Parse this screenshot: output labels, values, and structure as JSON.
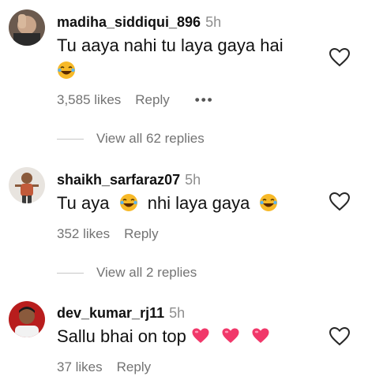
{
  "comments": [
    {
      "username": "madiha_siddiqui_896",
      "time": "5h",
      "text": "Tu aaya nahi tu laya gaya hai",
      "likes": "3,585 likes",
      "reply_label": "Reply",
      "more_label": "•••",
      "view_replies": "View all 62 replies",
      "emojis": [
        "laughing-emoji"
      ]
    },
    {
      "username": "shaikh_sarfaraz07",
      "time": "5h",
      "text_part1": "Tu aya",
      "text_part2": "nhi laya gaya",
      "likes": "352 likes",
      "reply_label": "Reply",
      "view_replies": "View all 2 replies",
      "emojis": [
        "laughing-emoji",
        "laughing-emoji"
      ]
    },
    {
      "username": "dev_kumar_rj11",
      "time": "5h",
      "text": "Sallu bhai on top",
      "likes": "37 likes",
      "reply_label": "Reply",
      "emojis": [
        "pink-heart-emoji",
        "pink-heart-emoji",
        "pink-heart-emoji"
      ]
    }
  ],
  "colors": {
    "muted_text": "#737373",
    "time_text": "#8e8e8e",
    "heart_emoji": "#f1386a",
    "laugh_emoji": "#f7b928"
  }
}
